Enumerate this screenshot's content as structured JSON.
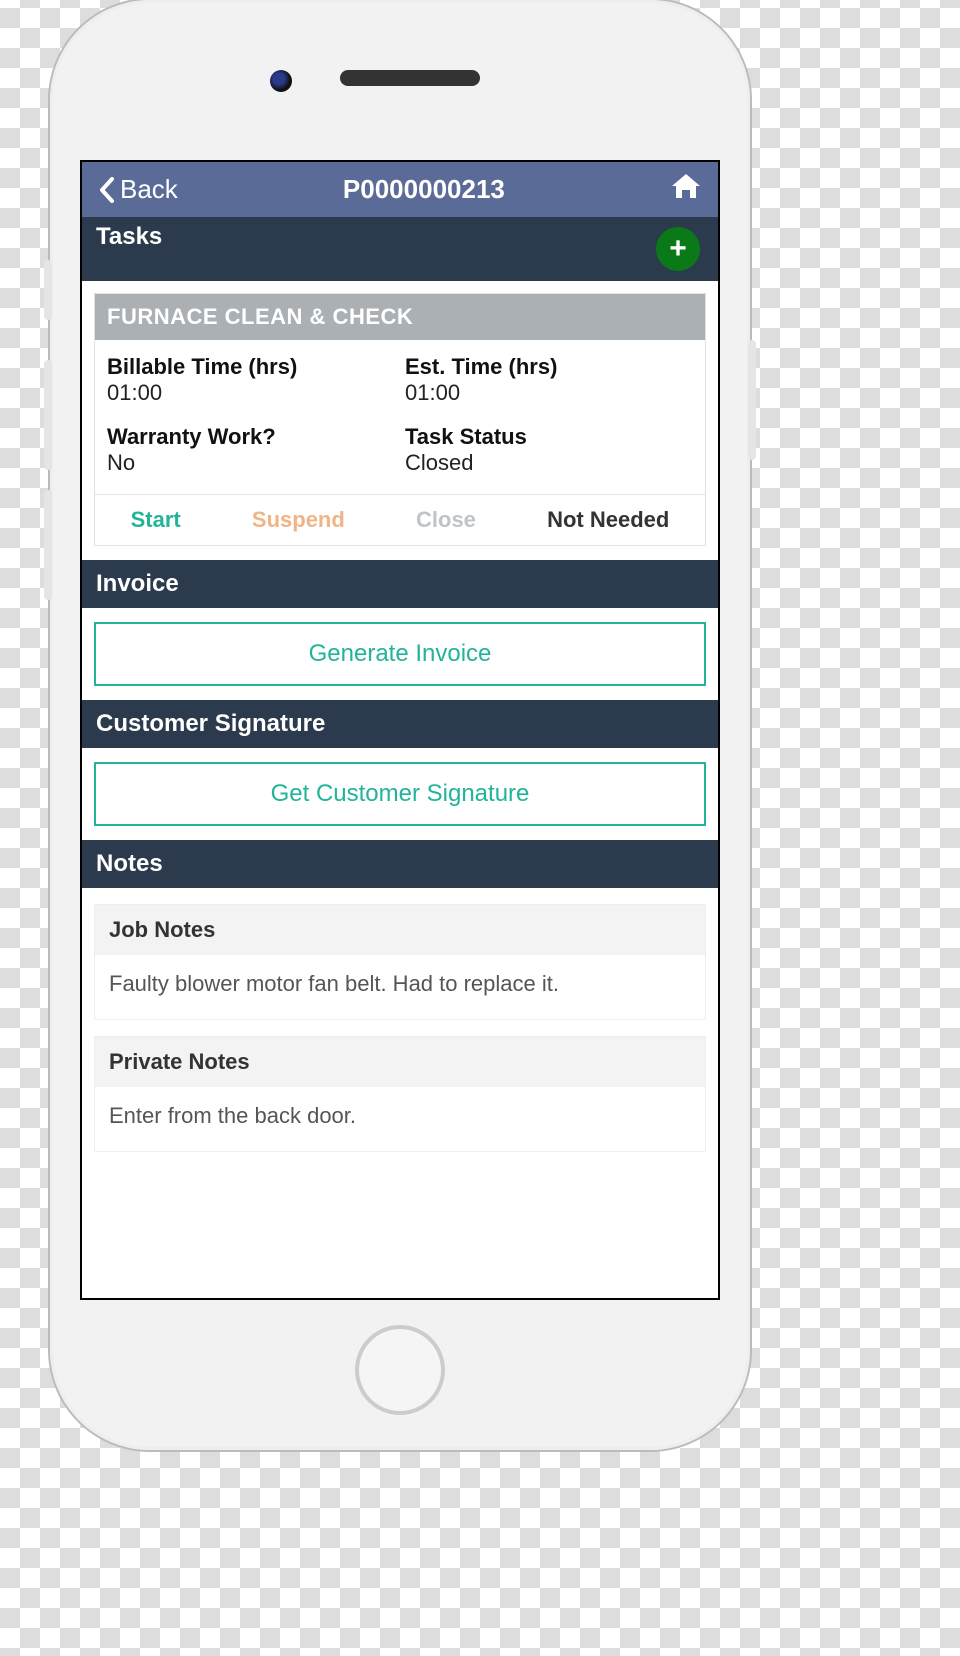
{
  "header": {
    "back_label": "Back",
    "title": "P0000000213"
  },
  "tasks": {
    "heading": "Tasks",
    "card": {
      "title": "FURNACE CLEAN & CHECK",
      "billable_label": "Billable Time (hrs)",
      "billable_value": "01:00",
      "est_label": "Est. Time (hrs)",
      "est_value": "01:00",
      "warranty_label": "Warranty Work?",
      "warranty_value": "No",
      "status_label": "Task Status",
      "status_value": "Closed",
      "actions": {
        "start": "Start",
        "suspend": "Suspend",
        "close": "Close",
        "not_needed": "Not Needed"
      }
    }
  },
  "invoice": {
    "heading": "Invoice",
    "button": "Generate Invoice"
  },
  "signature": {
    "heading": "Customer Signature",
    "button": "Get Customer Signature"
  },
  "notes": {
    "heading": "Notes",
    "job": {
      "title": "Job Notes",
      "body": "Faulty blower motor fan belt. Had to replace it."
    },
    "private": {
      "title": "Private Notes",
      "body": "Enter from the back door."
    }
  }
}
